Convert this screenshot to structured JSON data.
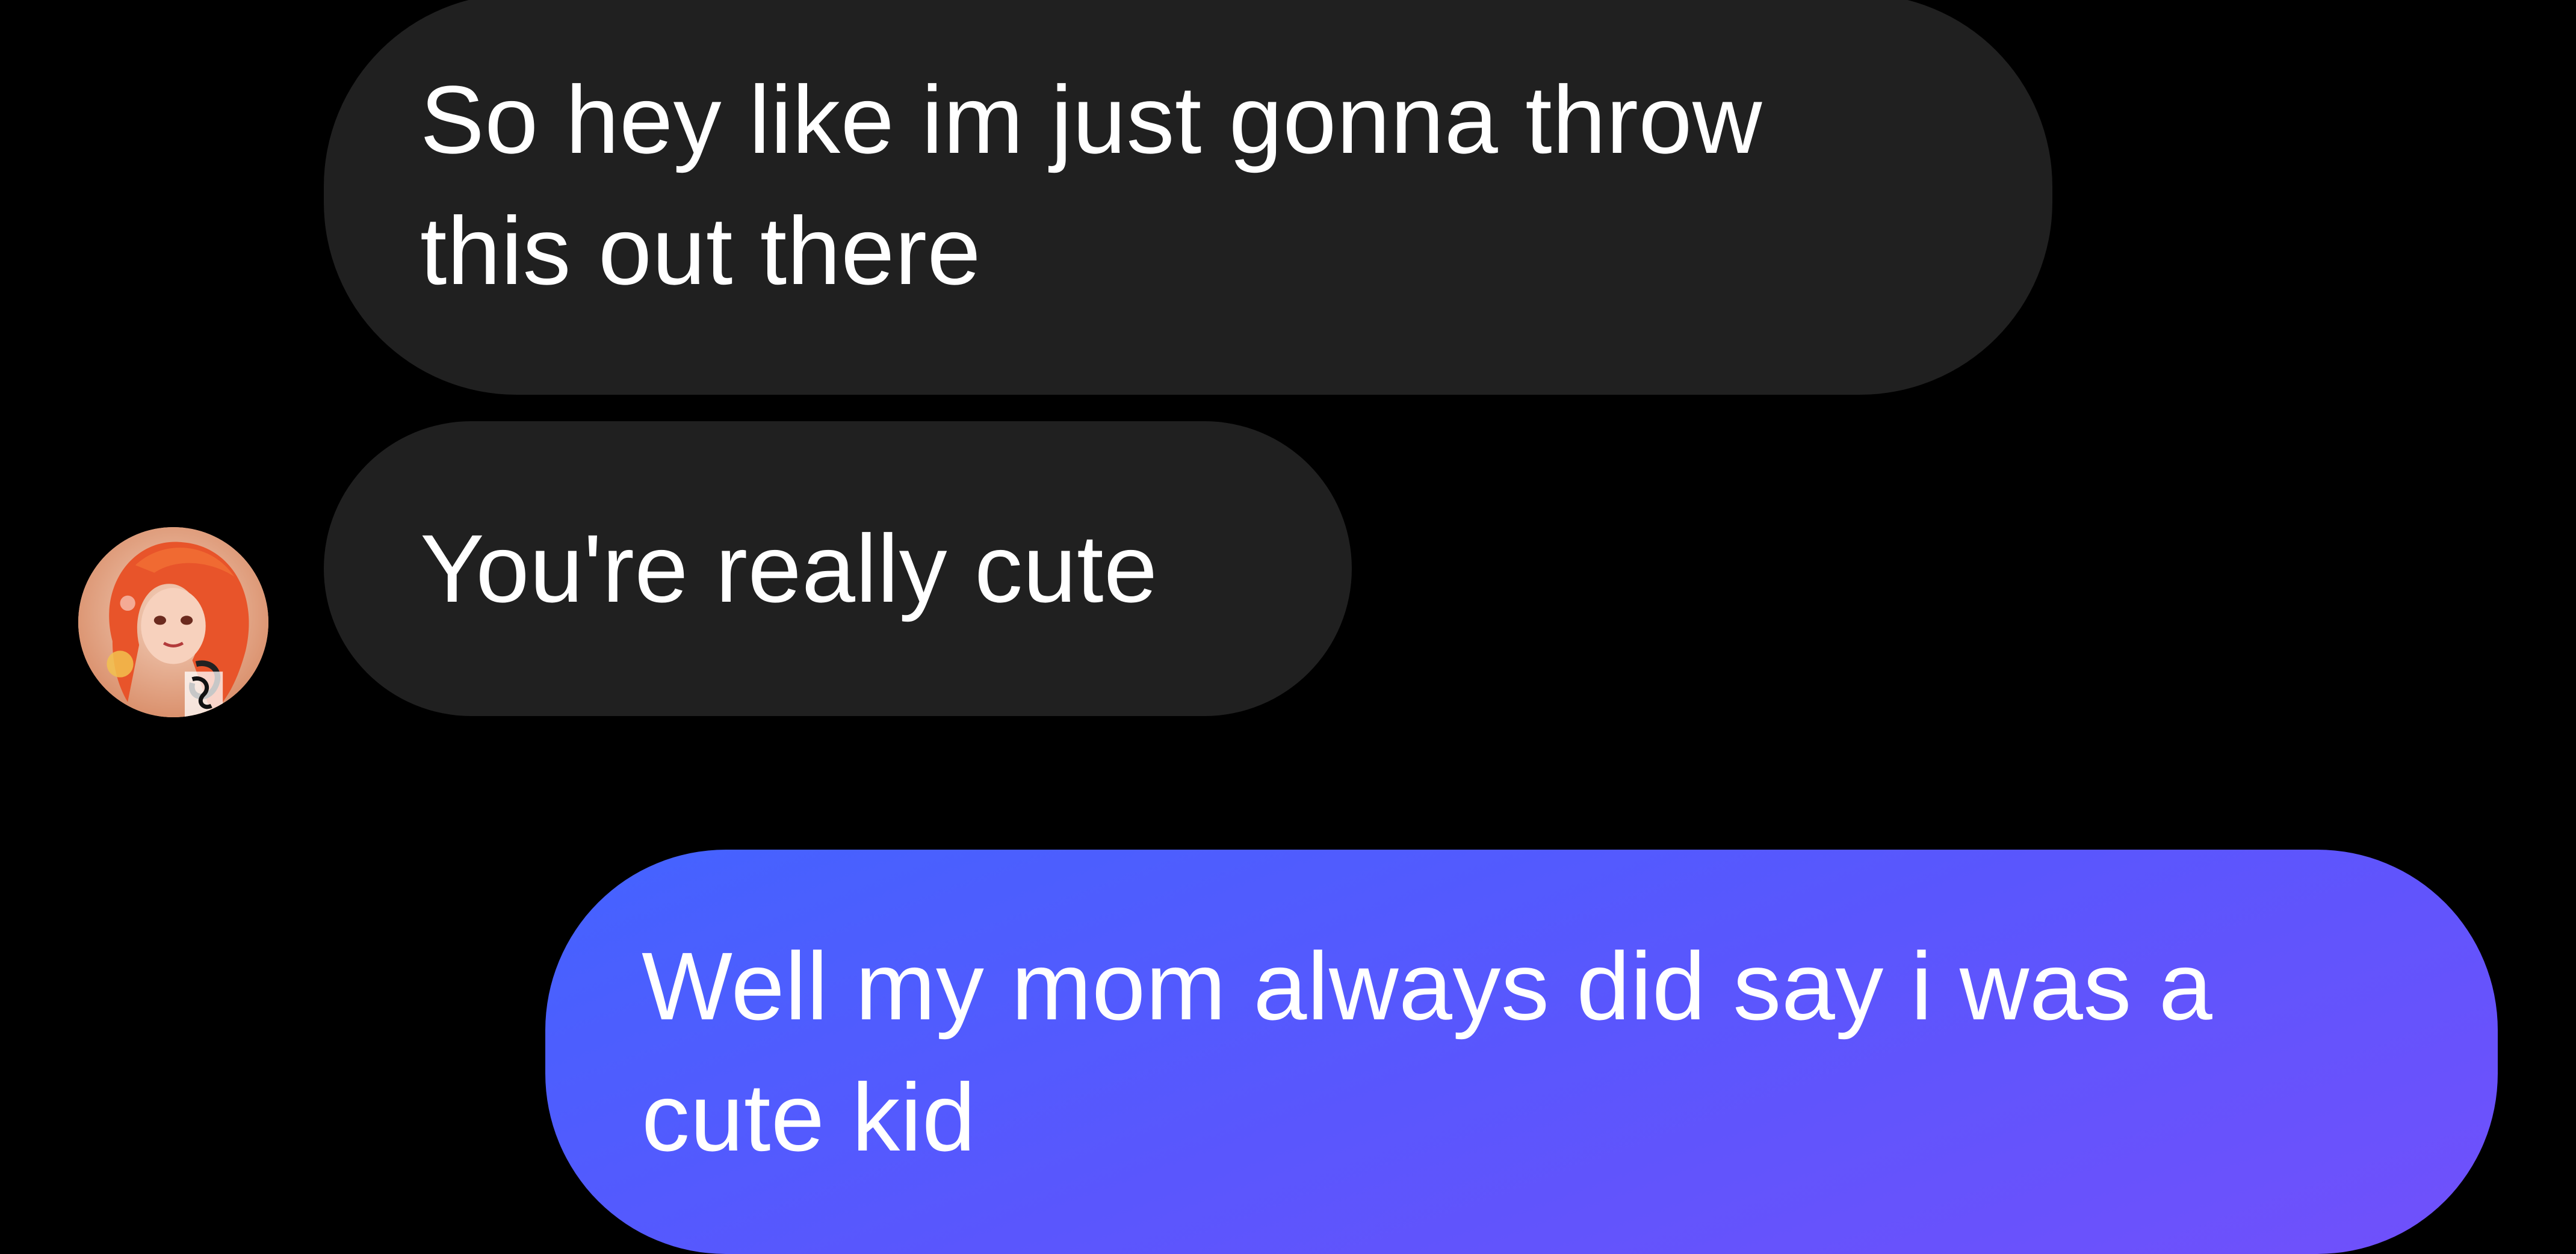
{
  "conversation": {
    "messages": [
      {
        "direction": "incoming",
        "lines": [
          "So hey like im just gonna throw",
          "this out there"
        ]
      },
      {
        "direction": "incoming",
        "lines": [
          "You're really cute"
        ]
      },
      {
        "direction": "outgoing",
        "lines": [
          "Well my mom always did say i was a",
          "cute kid"
        ]
      }
    ],
    "contact_avatar": {
      "icon": "contact-avatar-icon"
    }
  },
  "theme": {
    "background": "#000000",
    "incoming_bubble": "#202020",
    "outgoing_gradient_start": "#4463ff",
    "outgoing_gradient_end": "#7150fb",
    "text": "#ffffff"
  }
}
